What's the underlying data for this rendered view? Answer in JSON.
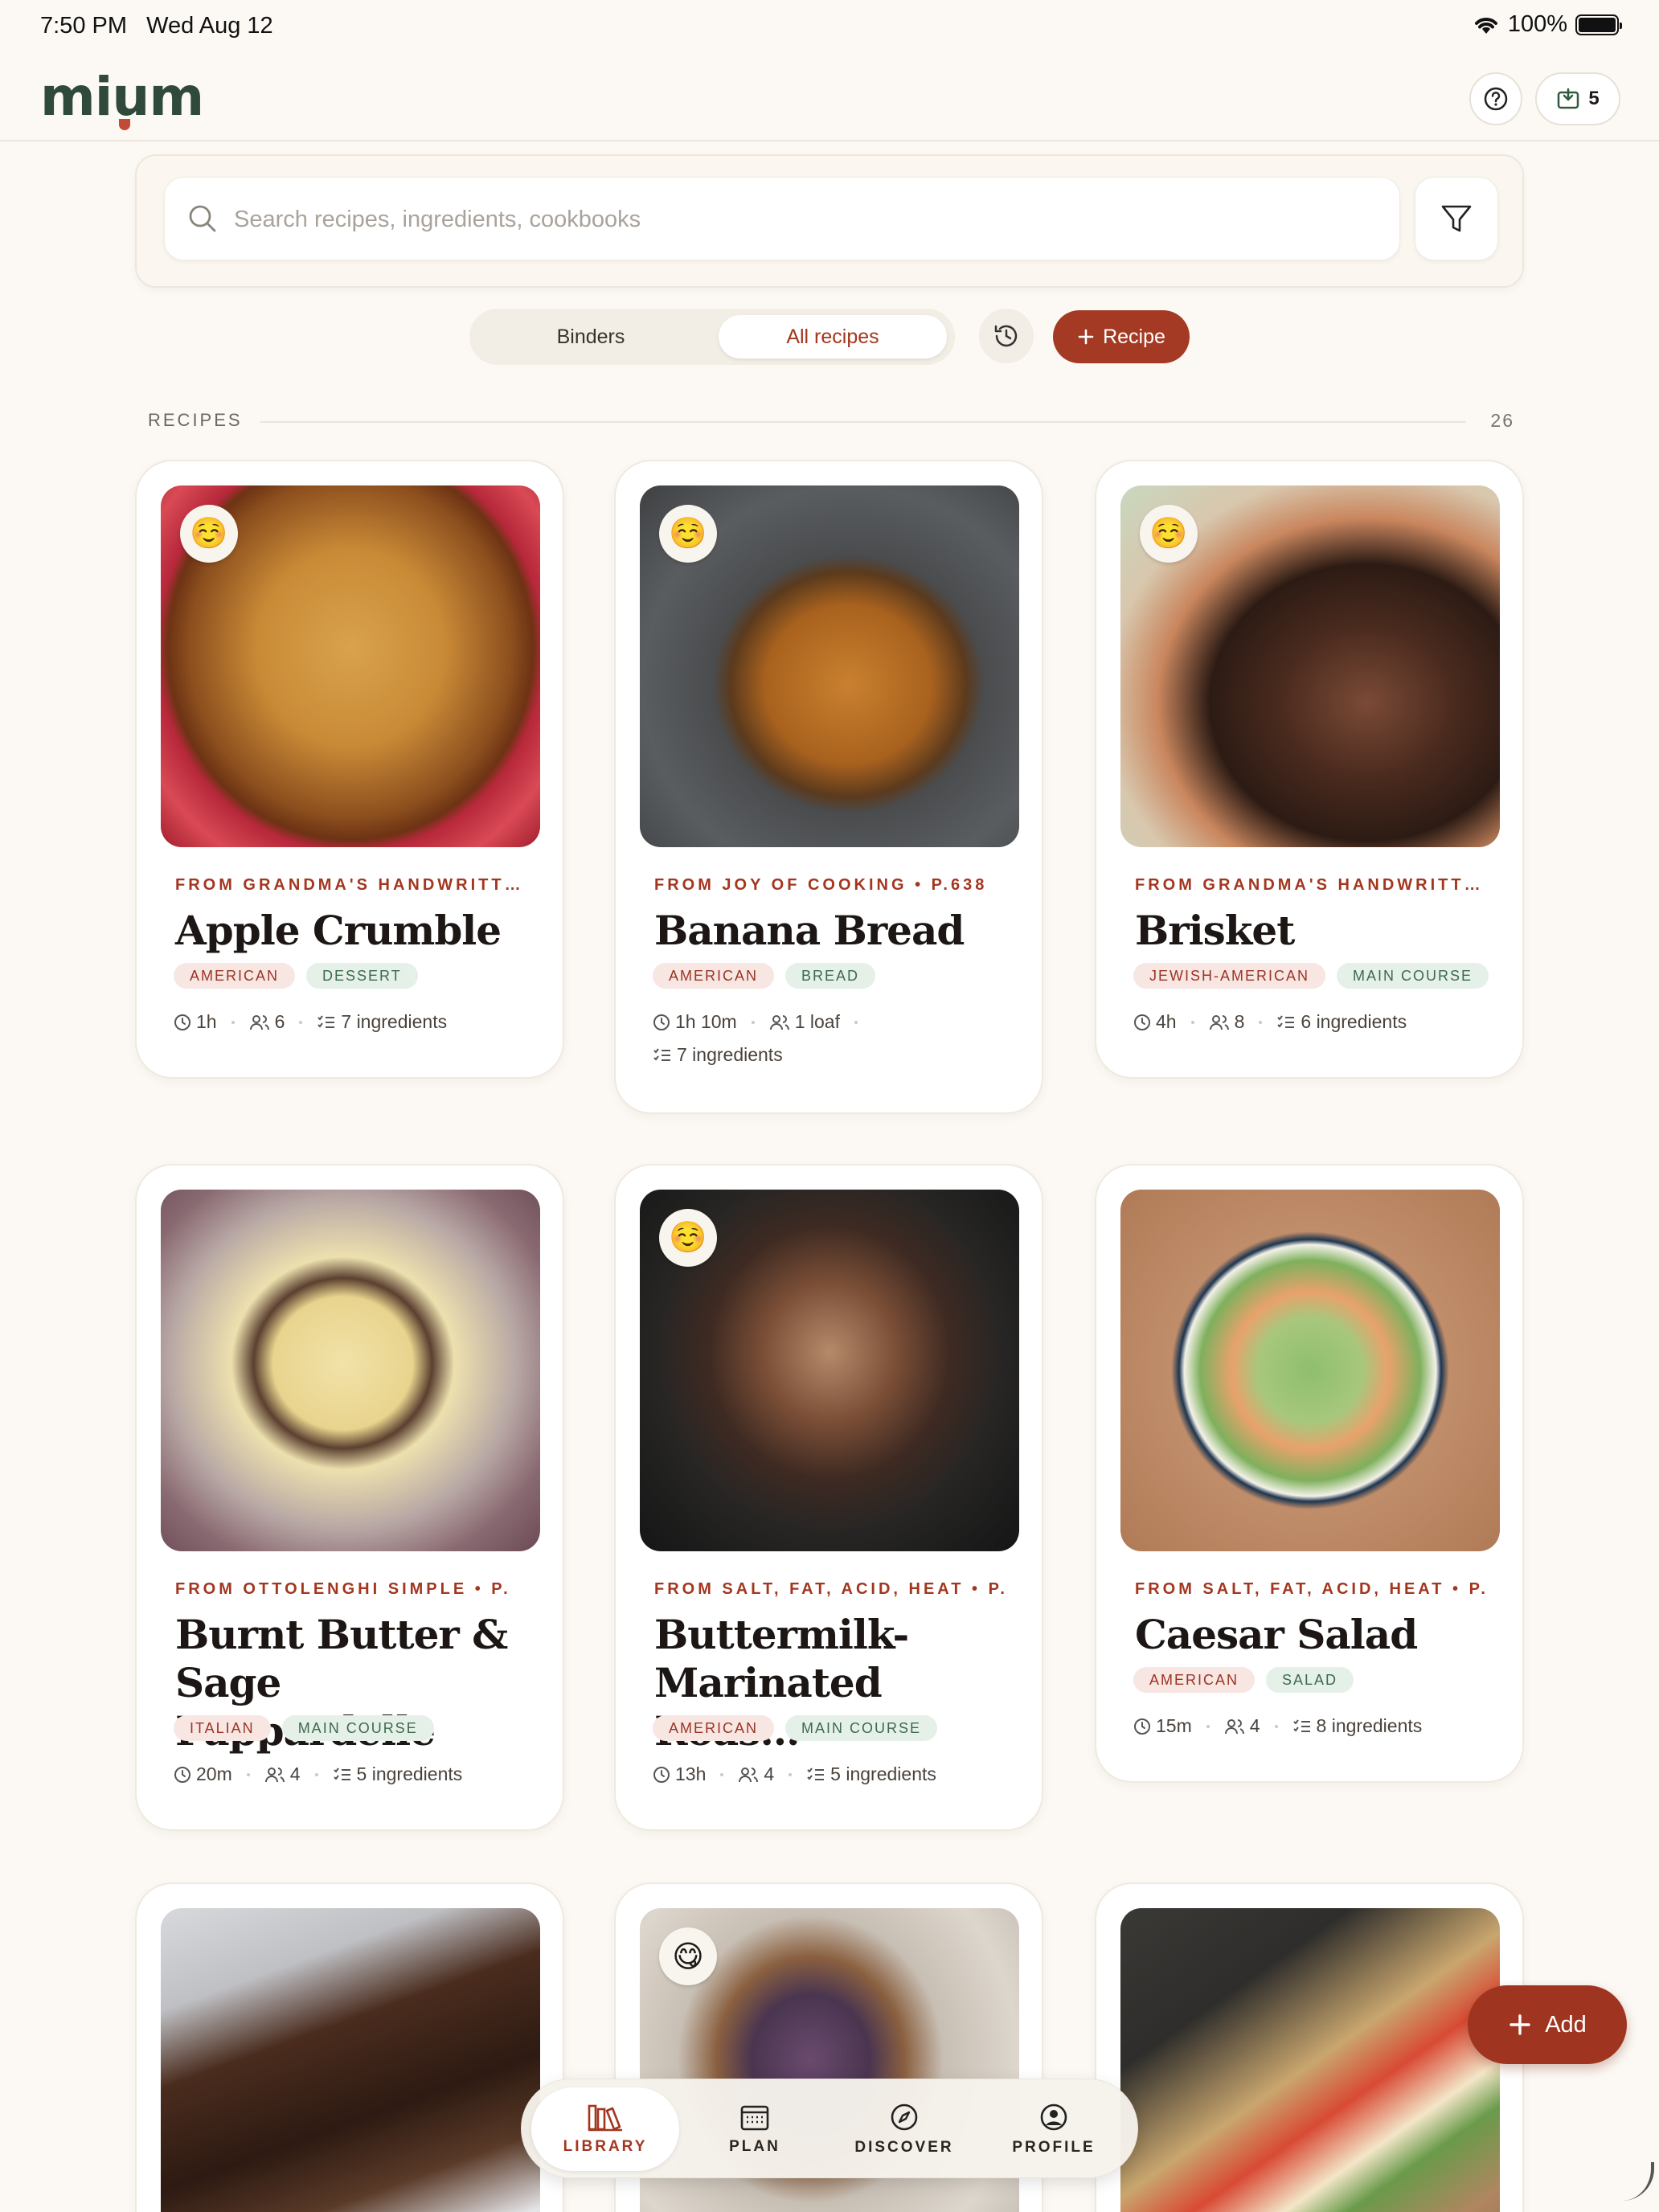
{
  "status": {
    "time": "7:50 PM",
    "date": "Wed Aug 12",
    "battery": "100%"
  },
  "header": {
    "logo": "mium",
    "inbox_count": "5"
  },
  "search": {
    "placeholder": "Search recipes, ingredients, cookbooks"
  },
  "tabs": {
    "binders": "Binders",
    "all": "All recipes",
    "recipe_button": "Recipe"
  },
  "section": {
    "title": "RECIPES",
    "count": "26"
  },
  "recipes": [
    {
      "emoji": "☺️",
      "source": "FROM GRANDMA'S HANDWRITTEN",
      "title": "Apple Crumble",
      "tags": [
        "AMERICAN",
        "DESSERT"
      ],
      "time": "1h",
      "serves": "6",
      "ingredients": "7 ingredients"
    },
    {
      "emoji": "☺️",
      "source": "FROM JOY OF COOKING • P.638",
      "title": "Banana Bread",
      "tags": [
        "AMERICAN",
        "BREAD"
      ],
      "time": "1h 10m",
      "serves": "1 loaf",
      "ingredients": "7 ingredients"
    },
    {
      "emoji": "☺️",
      "source": "FROM GRANDMA'S HANDWRITTEN",
      "title": "Brisket",
      "tags": [
        "JEWISH-AMERICAN",
        "MAIN COURSE"
      ],
      "time": "4h",
      "serves": "8",
      "ingredients": "6 ingredients"
    },
    {
      "emoji": "",
      "source": "FROM OTTOLENGHI SIMPLE • P.",
      "title": "Burnt Butter & Sage Pappardelle",
      "tags": [
        "ITALIAN",
        "MAIN COURSE"
      ],
      "time": "20m",
      "serves": "4",
      "ingredients": "5 ingredients"
    },
    {
      "emoji": "☺️",
      "source": "FROM SALT, FAT, ACID, HEAT • P.",
      "title": "Buttermilk-Marinated Roas…",
      "tags": [
        "AMERICAN",
        "MAIN COURSE"
      ],
      "time": "13h",
      "serves": "4",
      "ingredients": "5 ingredients"
    },
    {
      "emoji": "",
      "source": "FROM SALT, FAT, ACID, HEAT • P.",
      "title": "Caesar Salad",
      "tags": [
        "AMERICAN",
        "SALAD"
      ],
      "time": "15m",
      "serves": "4",
      "ingredients": "8 ingredients"
    },
    {
      "emoji": ""
    },
    {
      "emoji": "😋"
    },
    {
      "emoji": ""
    }
  ],
  "nav": {
    "library": "LIBRARY",
    "plan": "PLAN",
    "discover": "DISCOVER",
    "profile": "PROFILE"
  },
  "fab": {
    "label": "Add"
  },
  "colors": {
    "accent": "#a53a24",
    "background": "#fcf9f4",
    "logo": "#2f4a3a"
  }
}
